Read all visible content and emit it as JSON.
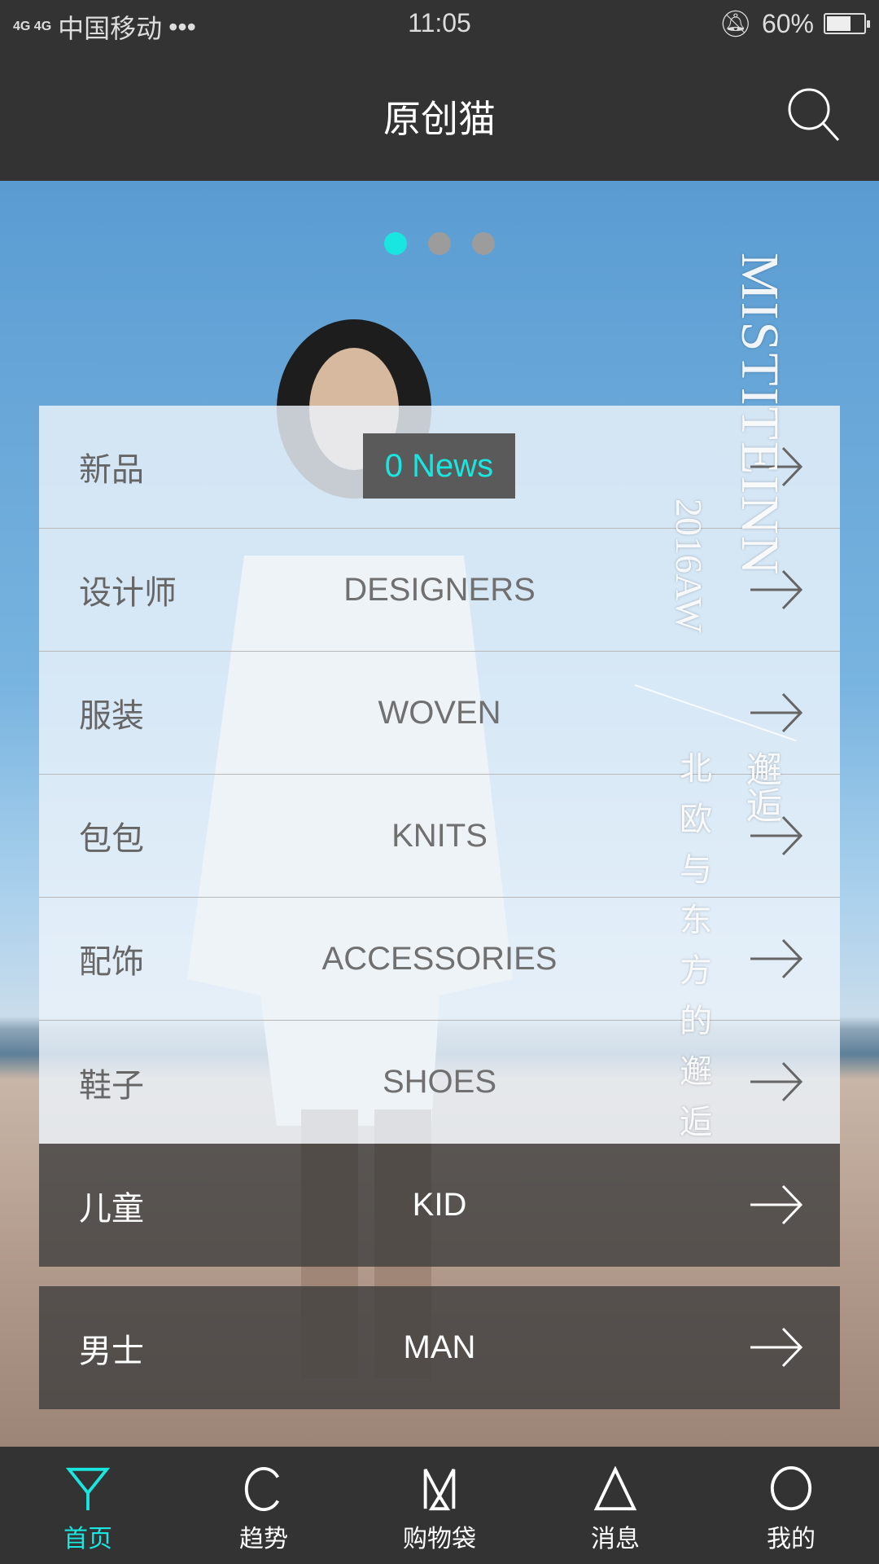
{
  "status_bar": {
    "signal": "4G 4G",
    "carrier": "中国移动",
    "more": "•••",
    "time": "11:05",
    "battery": "60%",
    "battery_level": 0.6
  },
  "header": {
    "title": "原创猫",
    "search_icon": "search-icon"
  },
  "banner": {
    "carousel_pages": 3,
    "active_page": 1,
    "brand_text": "MISTITEINN",
    "season_text": "2016AW",
    "title_text": "邂逅",
    "subtitle_text": "北欧与东方的邂逅"
  },
  "menu": [
    {
      "zh": "新品",
      "en": "0 News",
      "badge": true
    },
    {
      "zh": "设计师",
      "en": "DESIGNERS"
    },
    {
      "zh": "服装",
      "en": "WOVEN"
    },
    {
      "zh": "包包",
      "en": "KNITS"
    },
    {
      "zh": "配饰",
      "en": "ACCESSORIES"
    },
    {
      "zh": "鞋子",
      "en": "SHOES"
    },
    {
      "zh": "儿童",
      "en": "KID",
      "dark": true
    },
    {
      "zh": "男士",
      "en": "MAN",
      "dark": true
    }
  ],
  "bottom_nav": [
    {
      "label": "首页",
      "icon": "y-icon",
      "active": true
    },
    {
      "label": "趋势",
      "icon": "c-icon"
    },
    {
      "label": "购物袋",
      "icon": "m-icon"
    },
    {
      "label": "消息",
      "icon": "triangle-icon"
    },
    {
      "label": "我的",
      "icon": "circle-icon"
    }
  ],
  "colors": {
    "accent": "#19e6e0",
    "bar": "#333333"
  }
}
